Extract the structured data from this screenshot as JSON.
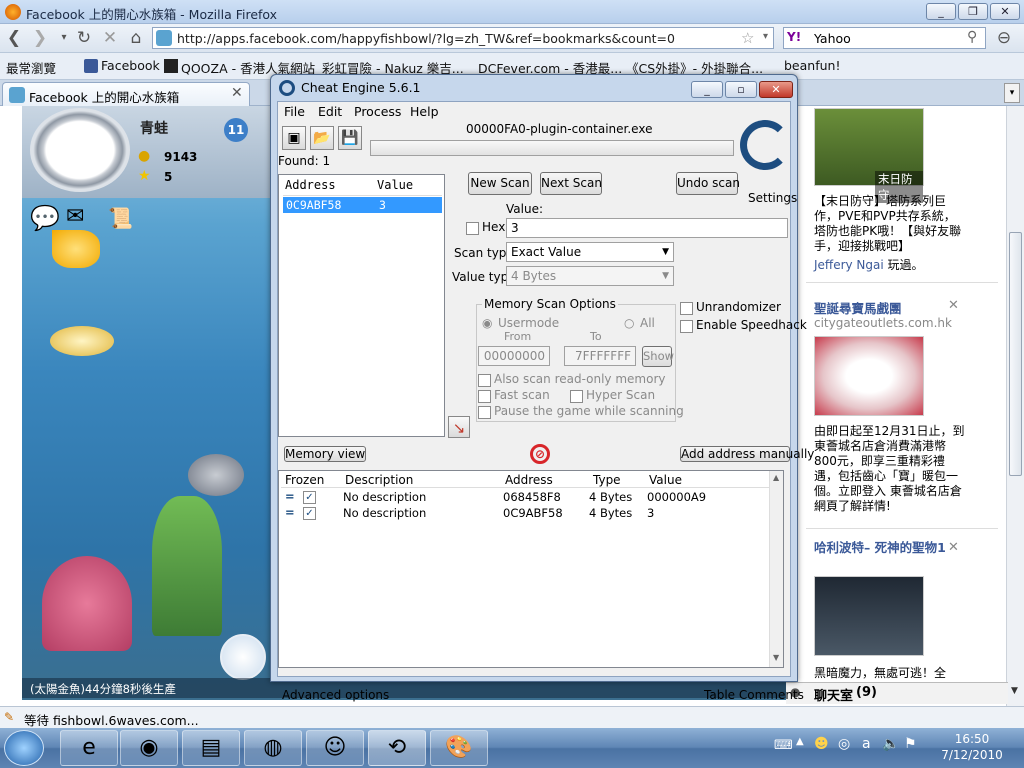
{
  "browser": {
    "window_title": "Facebook 上的開心水族箱 - Mozilla Firefox",
    "url": "http://apps.facebook.com/happyfishbowl/?lg=zh_TW&ref=bookmarks&count=0",
    "search_engine": "Yahoo",
    "bookmarks": [
      "最常瀏覽",
      "Facebook",
      "QOOZA - 香港人氣網站",
      "彩虹冒險 - Nakuz 樂吉...",
      "DCFever.com - 香港最...",
      "《CS外掛》- 外掛聯合...",
      "beanfun!"
    ],
    "tab_title": "Facebook 上的開心水族箱",
    "status_text": "等待 fishbowl.6waves.com..."
  },
  "game": {
    "player_name": "青蛙",
    "coins": "9143",
    "stars": "5",
    "level": "11",
    "status_text": "(太陽金魚)44分鐘8秒後生產"
  },
  "sidebar": {
    "ad1_caption": "末日防守",
    "ad1_text": "【末日防守】塔防系列巨作，PVE和PVP共存系統，塔防也能PK哦！【與好友聯手，迎接挑戰吧】",
    "ad1_user": "Jeffery Ngai",
    "ad1_user_suffix": "玩過。",
    "ad2_title": "聖誕尋寶馬戲團",
    "ad2_url": "citygateoutlets.com.hk",
    "ad2_text": "由即日起至12月31日止，到東薈城名店倉消費滿港幣800元，即享三重精彩禮遇，包括齒心「寶」暖包一個。立即登入 東薈城名店倉網頁了解詳情!",
    "ad3_title": "哈利波特– 死神的聖物1",
    "ad3_text": "黑暗魔力，無處可逃！全",
    "chat_label": "聊天室",
    "chat_count": "(9)"
  },
  "cheat_engine": {
    "title": "Cheat Engine 5.6.1",
    "menu": [
      "File",
      "Edit",
      "Process",
      "Help"
    ],
    "process_name": "00000FA0-plugin-container.exe",
    "found_label": "Found: 1",
    "found_columns": [
      "Address",
      "Value"
    ],
    "found_rows": [
      {
        "address": "0C9ABF58",
        "value": "3"
      }
    ],
    "buttons": {
      "new_scan": "New Scan",
      "next_scan": "Next Scan",
      "undo_scan": "Undo scan",
      "settings": "Settings",
      "memory_view": "Memory view",
      "add_address_manually": "Add address manually",
      "show": "Show"
    },
    "value_label": "Value:",
    "hex_label": "Hex",
    "value_input": "3",
    "scan_type_label": "Scan type",
    "scan_type_value": "Exact Value",
    "value_type_label": "Value type",
    "value_type_value": "4 Bytes",
    "memory_scan_options": {
      "title": "Memory Scan Options",
      "usermode": "Usermode",
      "all": "All",
      "from_label": "From",
      "to_label": "To",
      "from_value": "00000000",
      "to_value": "7FFFFFFF",
      "readonly": "Also scan read-only memory",
      "fast_scan": "Fast scan",
      "hyper_scan": "Hyper Scan",
      "pause_game": "Pause the game while scanning"
    },
    "unrandomizer": "Unrandomizer",
    "enable_speedhack": "Enable Speedhack",
    "table_columns": [
      "Frozen",
      "Description",
      "Address",
      "Type",
      "Value"
    ],
    "table_rows": [
      {
        "frozen_mark": "=",
        "description": "No description",
        "address": "068458F8",
        "type": "4 Bytes",
        "value": "000000A9"
      },
      {
        "frozen_mark": "=",
        "description": "No description",
        "address": "0C9ABF58",
        "type": "4 Bytes",
        "value": "3"
      }
    ],
    "advanced_options": "Advanced options",
    "table_comments": "Table Comments"
  },
  "taskbar": {
    "time": "16:50",
    "date": "7/12/2010"
  },
  "colors": {
    "selection": "#3399ff",
    "link": "#3b5998",
    "taskbar": "#5f86b5"
  }
}
